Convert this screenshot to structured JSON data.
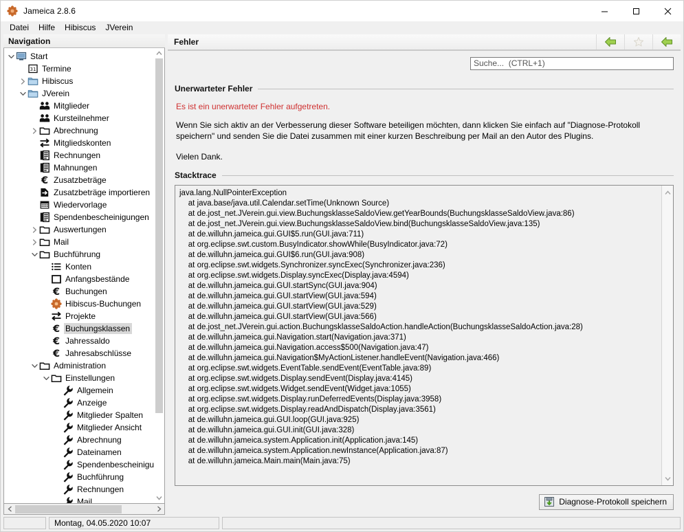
{
  "window": {
    "title": "Jameica 2.8.6",
    "app_icon": "jameica-flower-icon",
    "minimize_label": "—",
    "maximize_label": "□",
    "close_label": "✕"
  },
  "menubar": {
    "items": [
      {
        "label": "Datei",
        "name": "menu-datei"
      },
      {
        "label": "Hilfe",
        "name": "menu-hilfe"
      },
      {
        "label": "Hibiscus",
        "name": "menu-hibiscus"
      },
      {
        "label": "JVerein",
        "name": "menu-jverein"
      }
    ]
  },
  "navigation": {
    "header": "Navigation",
    "items": [
      {
        "label": "Start",
        "indent": 0,
        "twisty": "down",
        "icon": "monitor-icon",
        "selected": false
      },
      {
        "label": "Termine",
        "indent": 1,
        "twisty": "none",
        "icon": "calendar-icon",
        "selected": false
      },
      {
        "label": "Hibiscus",
        "indent": 1,
        "twisty": "right",
        "icon": "folder-icon",
        "selected": false
      },
      {
        "label": "JVerein",
        "indent": 1,
        "twisty": "down",
        "icon": "folder-icon",
        "selected": false
      },
      {
        "label": "Mitglieder",
        "indent": 2,
        "twisty": "none",
        "icon": "people-icon",
        "selected": false
      },
      {
        "label": "Kursteilnehmer",
        "indent": 2,
        "twisty": "none",
        "icon": "people-icon",
        "selected": false
      },
      {
        "label": "Abrechnung",
        "indent": 2,
        "twisty": "right",
        "icon": "folder-open-outline-icon",
        "selected": false
      },
      {
        "label": "Mitgliedskonten",
        "indent": 2,
        "twisty": "none",
        "icon": "transfer-icon",
        "selected": false
      },
      {
        "label": "Rechnungen",
        "indent": 2,
        "twisty": "none",
        "icon": "document-icon",
        "selected": false
      },
      {
        "label": "Mahnungen",
        "indent": 2,
        "twisty": "none",
        "icon": "document-icon",
        "selected": false
      },
      {
        "label": "Zusatzbeträge",
        "indent": 2,
        "twisty": "none",
        "icon": "euro-icon",
        "selected": false
      },
      {
        "label": "Zusatzbeträge importieren",
        "indent": 2,
        "twisty": "none",
        "icon": "import-icon",
        "selected": false
      },
      {
        "label": "Wiedervorlage",
        "indent": 2,
        "twisty": "none",
        "icon": "calendar-grid-icon",
        "selected": false
      },
      {
        "label": "Spendenbescheinigungen",
        "indent": 2,
        "twisty": "none",
        "icon": "document-icon",
        "selected": false
      },
      {
        "label": "Auswertungen",
        "indent": 2,
        "twisty": "right",
        "icon": "folder-open-outline-icon",
        "selected": false
      },
      {
        "label": "Mail",
        "indent": 2,
        "twisty": "right",
        "icon": "folder-open-outline-icon",
        "selected": false
      },
      {
        "label": "Buchführung",
        "indent": 2,
        "twisty": "down",
        "icon": "folder-open-outline-icon",
        "selected": false
      },
      {
        "label": "Konten",
        "indent": 3,
        "twisty": "none",
        "icon": "list-icon",
        "selected": false
      },
      {
        "label": "Anfangsbestände",
        "indent": 3,
        "twisty": "none",
        "icon": "square-icon",
        "selected": false
      },
      {
        "label": "Buchungen",
        "indent": 3,
        "twisty": "none",
        "icon": "euro-icon",
        "selected": false
      },
      {
        "label": "Hibiscus-Buchungen",
        "indent": 3,
        "twisty": "none",
        "icon": "jameica-flower-icon",
        "selected": false
      },
      {
        "label": "Projekte",
        "indent": 3,
        "twisty": "none",
        "icon": "transfer-icon",
        "selected": false
      },
      {
        "label": "Buchungsklassen",
        "indent": 3,
        "twisty": "none",
        "icon": "euro-icon",
        "selected": true
      },
      {
        "label": "Jahressaldo",
        "indent": 3,
        "twisty": "none",
        "icon": "euro-icon",
        "selected": false
      },
      {
        "label": "Jahresabschlüsse",
        "indent": 3,
        "twisty": "none",
        "icon": "euro-icon",
        "selected": false
      },
      {
        "label": "Administration",
        "indent": 2,
        "twisty": "down",
        "icon": "folder-open-outline-icon",
        "selected": false
      },
      {
        "label": "Einstellungen",
        "indent": 3,
        "twisty": "down",
        "icon": "folder-open-outline-icon",
        "selected": false
      },
      {
        "label": "Allgemein",
        "indent": 4,
        "twisty": "none",
        "icon": "wrench-icon",
        "selected": false
      },
      {
        "label": "Anzeige",
        "indent": 4,
        "twisty": "none",
        "icon": "wrench-icon",
        "selected": false
      },
      {
        "label": "Mitglieder Spalten",
        "indent": 4,
        "twisty": "none",
        "icon": "wrench-icon",
        "selected": false
      },
      {
        "label": "Mitglieder Ansicht",
        "indent": 4,
        "twisty": "none",
        "icon": "wrench-icon",
        "selected": false
      },
      {
        "label": "Abrechnung",
        "indent": 4,
        "twisty": "none",
        "icon": "wrench-icon",
        "selected": false
      },
      {
        "label": "Dateinamen",
        "indent": 4,
        "twisty": "none",
        "icon": "wrench-icon",
        "selected": false
      },
      {
        "label": "Spendenbescheinigun",
        "indent": 4,
        "twisty": "none",
        "icon": "wrench-icon",
        "selected": false
      },
      {
        "label": "Buchführung",
        "indent": 4,
        "twisty": "none",
        "icon": "wrench-icon",
        "selected": false
      },
      {
        "label": "Rechnungen",
        "indent": 4,
        "twisty": "none",
        "icon": "wrench-icon",
        "selected": false
      },
      {
        "label": "Mail",
        "indent": 4,
        "twisty": "none",
        "icon": "wrench-icon",
        "selected": false
      }
    ]
  },
  "content": {
    "title": "Fehler",
    "toolbar": {
      "back": "back-arrow-icon",
      "favorite": "star-icon",
      "forward": "forward-arrow-icon"
    },
    "search": {
      "placeholder": "Suche...  (CTRL+1)",
      "value": ""
    },
    "error_section": {
      "heading": "Unerwarteter Fehler",
      "message": "Es ist ein unerwarteter Fehler aufgetreten.",
      "paragraph": "Wenn Sie sich aktiv an der Verbesserung dieser Software beteiligen möchten, dann klicken Sie einfach auf \"Diagnose-Protokoll speichern\" und senden Sie die Datei zusammen mit einer kurzen Beschreibung per Mail an den Autor des Plugins.",
      "thanks": "Vielen Dank."
    },
    "stacktrace_section": {
      "heading": "Stacktrace",
      "text": "java.lang.NullPointerException\n    at java.base/java.util.Calendar.setTime(Unknown Source)\n    at de.jost_net.JVerein.gui.view.BuchungsklasseSaldoView.getYearBounds(BuchungsklasseSaldoView.java:86)\n    at de.jost_net.JVerein.gui.view.BuchungsklasseSaldoView.bind(BuchungsklasseSaldoView.java:135)\n    at de.willuhn.jameica.gui.GUI$5.run(GUI.java:711)\n    at org.eclipse.swt.custom.BusyIndicator.showWhile(BusyIndicator.java:72)\n    at de.willuhn.jameica.gui.GUI$6.run(GUI.java:908)\n    at org.eclipse.swt.widgets.Synchronizer.syncExec(Synchronizer.java:236)\n    at org.eclipse.swt.widgets.Display.syncExec(Display.java:4594)\n    at de.willuhn.jameica.gui.GUI.startSync(GUI.java:904)\n    at de.willuhn.jameica.gui.GUI.startView(GUI.java:594)\n    at de.willuhn.jameica.gui.GUI.startView(GUI.java:529)\n    at de.willuhn.jameica.gui.GUI.startView(GUI.java:566)\n    at de.jost_net.JVerein.gui.action.BuchungsklasseSaldoAction.handleAction(BuchungsklasseSaldoAction.java:28)\n    at de.willuhn.jameica.gui.Navigation.start(Navigation.java:371)\n    at de.willuhn.jameica.gui.Navigation.access$500(Navigation.java:47)\n    at de.willuhn.jameica.gui.Navigation$MyActionListener.handleEvent(Navigation.java:466)\n    at org.eclipse.swt.widgets.EventTable.sendEvent(EventTable.java:89)\n    at org.eclipse.swt.widgets.Display.sendEvent(Display.java:4145)\n    at org.eclipse.swt.widgets.Widget.sendEvent(Widget.java:1055)\n    at org.eclipse.swt.widgets.Display.runDeferredEvents(Display.java:3958)\n    at org.eclipse.swt.widgets.Display.readAndDispatch(Display.java:3561)\n    at de.willuhn.jameica.gui.GUI.loop(GUI.java:925)\n    at de.willuhn.jameica.gui.GUI.init(GUI.java:328)\n    at de.willuhn.jameica.system.Application.init(Application.java:145)\n    at de.willuhn.jameica.system.Application.newInstance(Application.java:87)\n    at de.willuhn.jameica.Main.main(Main.java:75)"
    },
    "save_button": {
      "label": "Diagnose-Protokoll speichern",
      "icon": "save-download-icon"
    }
  },
  "statusbar": {
    "date": "Montag, 04.05.2020 10:07"
  },
  "colors": {
    "error_red": "#cf3030",
    "accent_green": "#8cc63f",
    "selection_gray": "#d8d8d8",
    "panel_bg": "#f0f0f0"
  }
}
